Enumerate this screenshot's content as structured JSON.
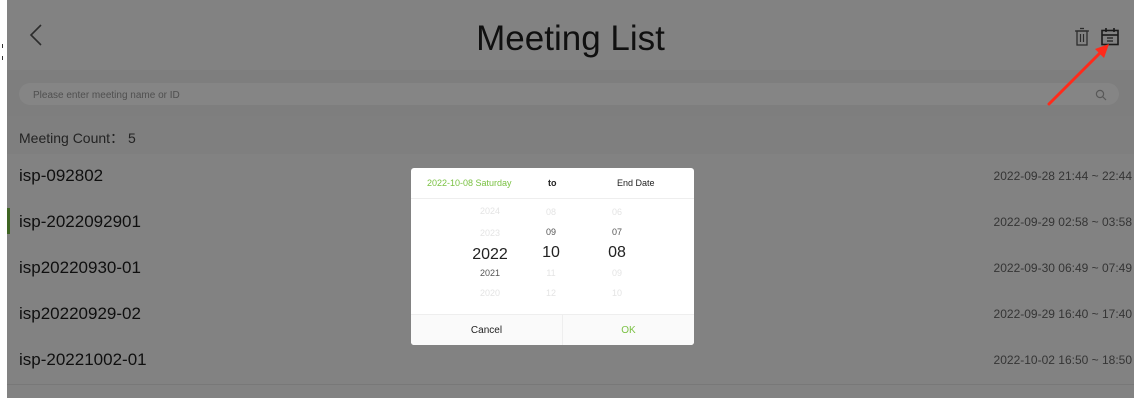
{
  "header": {
    "title": "Meeting List",
    "back_icon": "chevron-left-icon",
    "delete_icon": "trash-icon",
    "calendar_icon": "calendar-icon"
  },
  "search": {
    "placeholder": "Please enter meeting name or ID",
    "value": ""
  },
  "summary": {
    "count_label": "Meeting Count： 5"
  },
  "meetings": [
    {
      "name": "isp-092802",
      "time": "2022-09-28 21:44 ~ 22:44"
    },
    {
      "name": "isp-2022092901",
      "time": "2022-09-29 02:58 ~ 03:58"
    },
    {
      "name": "isp20220930-01",
      "time": "2022-09-30 06:49 ~ 07:49"
    },
    {
      "name": "isp20220929-02",
      "time": "2022-09-29 16:40 ~ 17:40"
    },
    {
      "name": "isp-20221002-01",
      "time": "2022-10-02 16:50 ~ 18:50"
    }
  ],
  "date_dialog": {
    "start_date": "2022-10-08 Saturday",
    "to_label": "to",
    "end_date": "End Date",
    "year_wheel": {
      "prev2": "2024",
      "prev1": "2023",
      "selected": "2022",
      "next1": "2021",
      "next2": "2020"
    },
    "month_wheel": {
      "prev2": "08",
      "prev1": "09",
      "selected": "10",
      "next1": "11",
      "next2": "12"
    },
    "day_wheel": {
      "prev2": "06",
      "prev1": "07",
      "selected": "08",
      "next1": "09",
      "next2": "10"
    },
    "cancel_label": "Cancel",
    "ok_label": "OK"
  },
  "colors": {
    "accent": "#7ac143",
    "annotation_arrow": "#ff2a1a",
    "overlay": "rgba(0,0,0,0.48)"
  }
}
